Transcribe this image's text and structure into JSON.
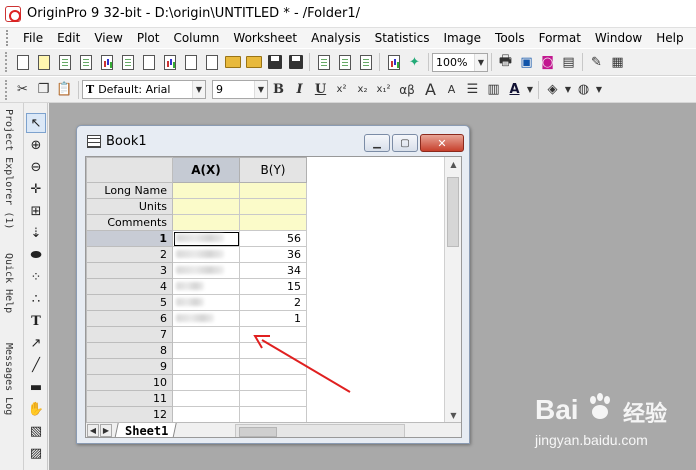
{
  "window": {
    "title": "OriginPro 9 32-bit - D:\\origin\\UNTITLED * - /Folder1/"
  },
  "menu": [
    "File",
    "Edit",
    "View",
    "Plot",
    "Column",
    "Worksheet",
    "Analysis",
    "Statistics",
    "Image",
    "Tools",
    "Format",
    "Window",
    "Help"
  ],
  "toolbar1": {
    "zoom_value": "100%"
  },
  "toolbar2": {
    "font_name": "Default: Arial",
    "font_size": "9",
    "bold_label": "B",
    "italic_label": "I",
    "underline_label": "U",
    "superscript_label": "x²",
    "subscript_label": "x₂",
    "supsub_label": "x₁²",
    "greek_label": "αβ",
    "font_up_label": "A",
    "font_down_label": "A"
  },
  "left_panels": {
    "project_explorer": "Project Explorer (1)",
    "quick_help": "Quick Help",
    "messages_log": "Messages Log"
  },
  "book": {
    "title": "Book1",
    "columns": [
      "A(X)",
      "B(Y)"
    ],
    "meta_rows": [
      "Long Name",
      "Units",
      "Comments"
    ],
    "rows": [
      {
        "n": "1",
        "a_hidden": true,
        "b": "56"
      },
      {
        "n": "2",
        "a_hidden": true,
        "b": "36"
      },
      {
        "n": "3",
        "a_hidden": true,
        "b": "34"
      },
      {
        "n": "4",
        "a_hidden": true,
        "b": "15"
      },
      {
        "n": "5",
        "a_hidden": true,
        "b": "2"
      },
      {
        "n": "6",
        "a_hidden": true,
        "b": "1"
      },
      {
        "n": "7",
        "a_hidden": false,
        "b": ""
      },
      {
        "n": "8",
        "a_hidden": false,
        "b": ""
      },
      {
        "n": "9",
        "a_hidden": false,
        "b": ""
      },
      {
        "n": "10",
        "a_hidden": false,
        "b": ""
      },
      {
        "n": "11",
        "a_hidden": false,
        "b": ""
      },
      {
        "n": "12",
        "a_hidden": false,
        "b": ""
      }
    ],
    "sheet_tab": "Sheet1"
  },
  "watermark": {
    "brand": "Bai",
    "cn": "经验",
    "url": "jingyan.baidu.com",
    "brand_color": "#ffffff"
  },
  "colors": {
    "meta_row": "#fbfbc9",
    "annotation_arrow": "#e02020",
    "close_button": "#c7402c"
  }
}
